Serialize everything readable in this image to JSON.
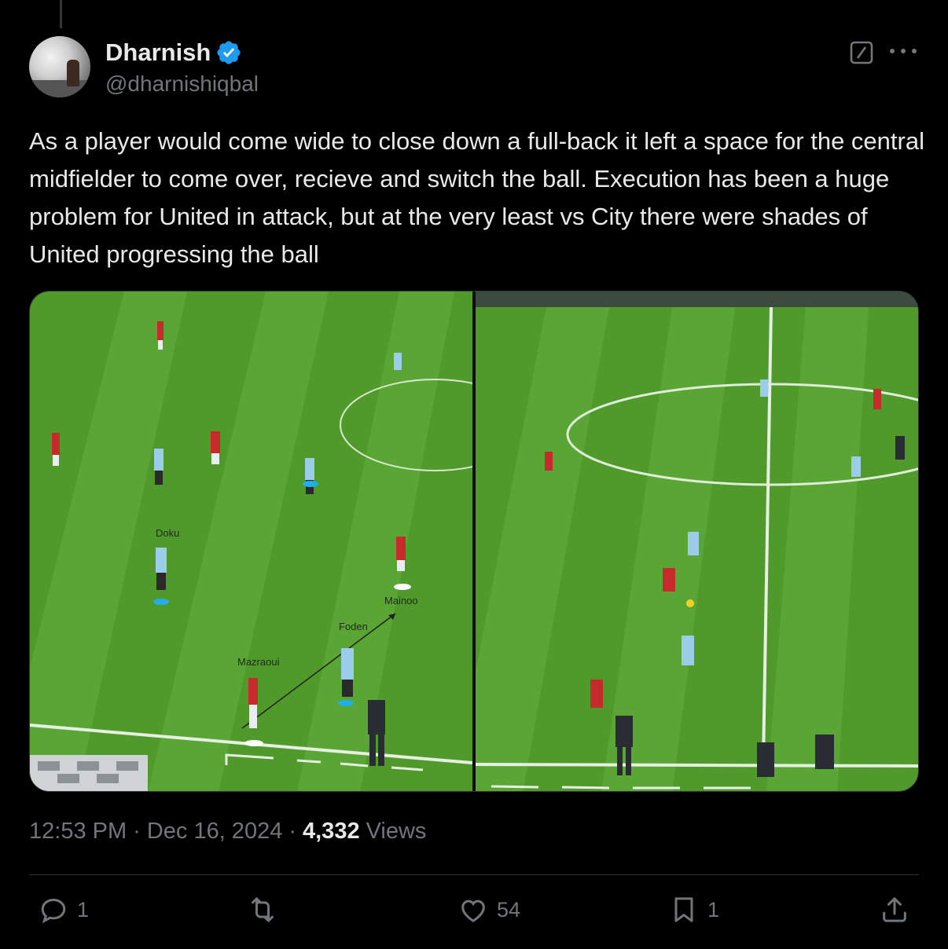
{
  "author": {
    "display_name": "Dharnish",
    "handle": "@dharnishiqbal",
    "verified": true
  },
  "tweet": {
    "text": "As a player would come wide to close down a full-back it left a space for the central midfielder to come over, recieve and switch the ball. Execution has been a huge problem for United in attack, but at the very least vs City there were shades of United progressing the ball"
  },
  "media": {
    "left_labels": [
      "Doku",
      "Mainoo",
      "Foden",
      "Mazraoui"
    ]
  },
  "meta": {
    "time": "12:53 PM",
    "date": "Dec 16, 2024",
    "views_count": "4,332",
    "views_label": "Views",
    "sep": "·"
  },
  "actions": {
    "reply_count": "1",
    "like_count": "54",
    "bookmark_count": "1"
  },
  "colors": {
    "background": "#000000",
    "text": "#e7e9ea",
    "muted": "#71767b",
    "verified": "#1d9bf0",
    "pitch": "#4e9a2a"
  },
  "icons": [
    "verified-badge-icon",
    "grok-icon",
    "more-icon",
    "reply-icon",
    "repost-icon",
    "like-icon",
    "bookmark-icon",
    "share-icon"
  ]
}
